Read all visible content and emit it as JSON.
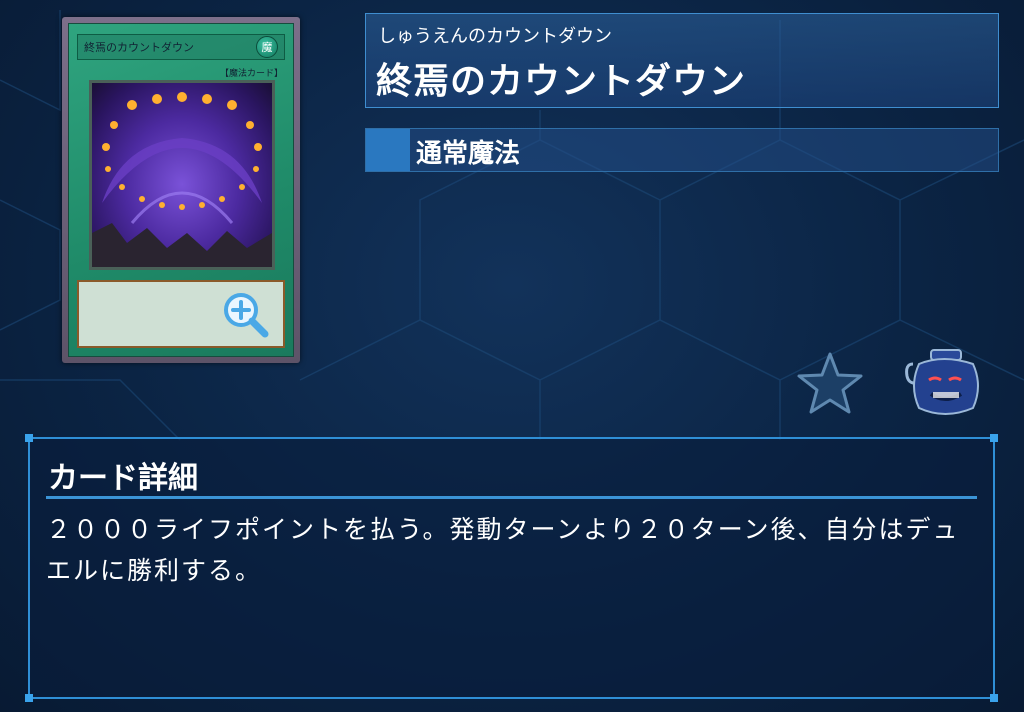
{
  "card": {
    "mini_name": "終焉のカウントダウン",
    "mini_attribute": "魔",
    "mini_type": "【魔法カード】"
  },
  "header": {
    "ruby": "しゅうえんのカウントダウン",
    "name": "終焉のカウントダウン",
    "card_type": "通常魔法"
  },
  "details": {
    "title": "カード詳細",
    "text": "２０００ライフポイントを払う。発動ターンより２０ターン後、自分はデュエルに勝利する。"
  },
  "colors": {
    "accent": "#2f8fd6",
    "card_frame": "#1f8a68",
    "background": "#0b2444"
  },
  "icons": [
    "zoom-icon",
    "star-icon",
    "pot-icon"
  ]
}
